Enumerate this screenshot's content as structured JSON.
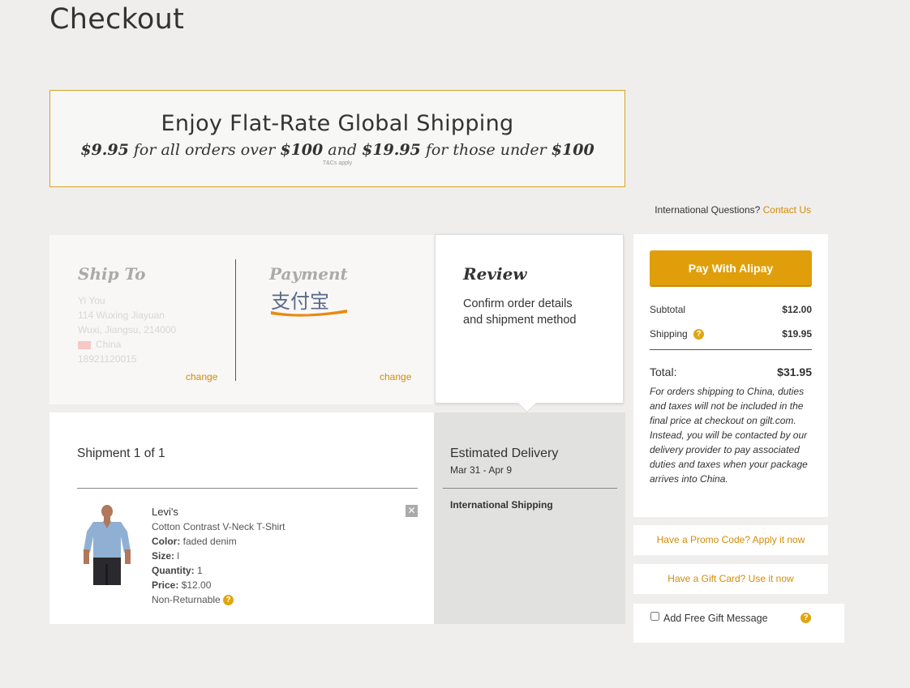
{
  "page": {
    "title": "Checkout"
  },
  "promo": {
    "headline": "Enjoy Flat-Rate Global Shipping",
    "rate_over": "$9.95",
    "text_for_all_over": "for all orders over",
    "threshold_1": "$100",
    "text_and": "and",
    "rate_under": "$19.95",
    "text_for_those_under": "for those under",
    "threshold_2": "$100",
    "terms": "T&Cs apply"
  },
  "intl": {
    "question": "International Questions?",
    "contact_link": "Contact Us"
  },
  "steps": {
    "ship_to": {
      "title": "Ship To",
      "name": "Yi You",
      "address1": "114 Wuxing Jiayuan",
      "address2": "Wuxi, Jiangsu, 214000",
      "country": "China",
      "phone": "18921120015",
      "change": "change"
    },
    "payment": {
      "title": "Payment",
      "logo_text": "支付宝",
      "change": "change"
    },
    "review": {
      "title": "Review",
      "desc_line1": "Confirm order details",
      "desc_line2": "and shipment method"
    }
  },
  "shipment": {
    "title": "Shipment 1 of 1",
    "item": {
      "brand": "Levi's",
      "name": "Cotton Contrast V-Neck T-Shirt",
      "color_label": "Color:",
      "color_value": "faded denim",
      "size_label": "Size:",
      "size_value": "l",
      "qty_label": "Quantity:",
      "qty_value": "1",
      "price_label": "Price:",
      "price_value": "$12.00",
      "returnable": "Non-Returnable",
      "remove_glyph": "✕"
    }
  },
  "delivery": {
    "title": "Estimated Delivery",
    "dates": "Mar 31 - Apr 9",
    "method": "International Shipping"
  },
  "summary": {
    "pay_button": "Pay With Alipay",
    "subtotal_label": "Subtotal",
    "subtotal_value": "$12.00",
    "shipping_label": "Shipping",
    "shipping_value": "$19.95",
    "total_label": "Total:",
    "total_value": "$31.95",
    "duties_note": "For orders shipping to China, duties and taxes will not be included in the final price at checkout on gilt.com. Instead, you will be contacted by our delivery provider to pay associated duties and taxes when your package arrives into China.",
    "help_glyph": "?"
  },
  "side": {
    "promo_code": "Have a Promo Code? Apply it now",
    "gift_card": "Have a Gift Card? Use it now",
    "gift_message": "Add Free Gift Message"
  },
  "colors": {
    "accent": "#e09f0a",
    "link": "#d28c0a",
    "banner_border": "#d9a227"
  }
}
